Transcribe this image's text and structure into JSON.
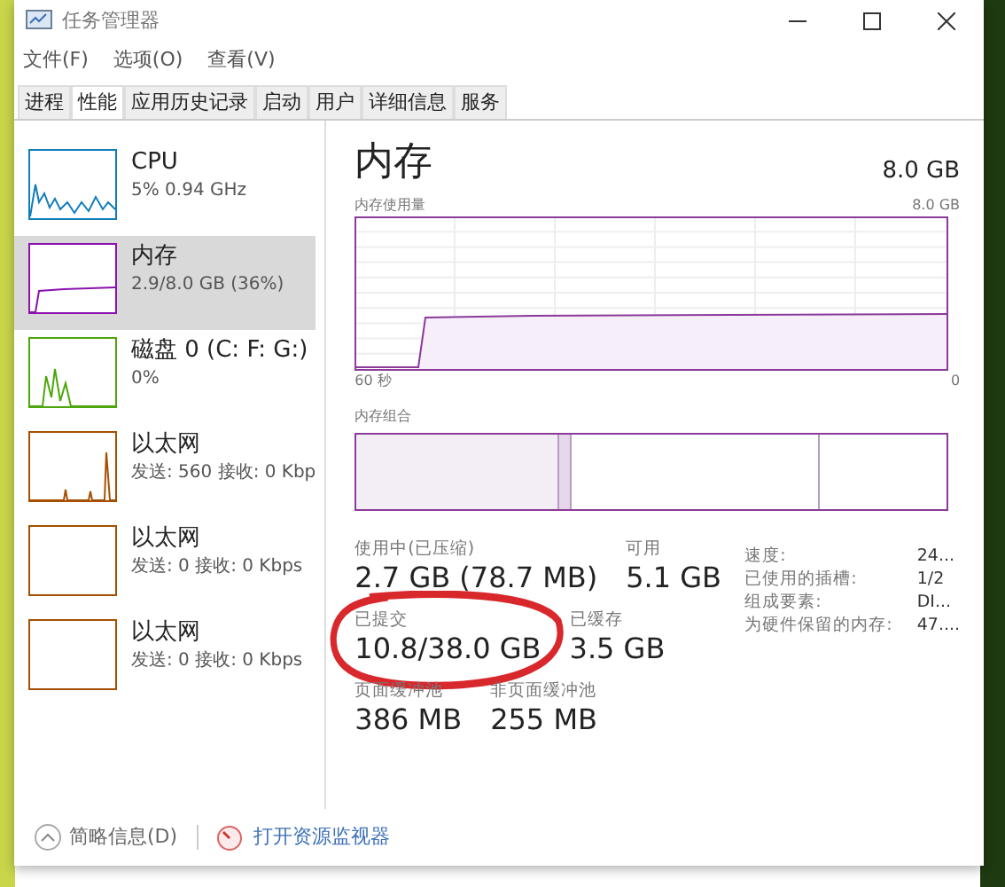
{
  "window": {
    "title": "任务管理器"
  },
  "menu": [
    "文件(F)",
    "选项(O)",
    "查看(V)"
  ],
  "tabs": [
    {
      "label": "进程",
      "selected": false
    },
    {
      "label": "性能",
      "selected": true
    },
    {
      "label": "应用历史记录",
      "selected": false
    },
    {
      "label": "启动",
      "selected": false
    },
    {
      "label": "用户",
      "selected": false
    },
    {
      "label": "详细信息",
      "selected": false
    },
    {
      "label": "服务",
      "selected": false
    }
  ],
  "sidebar": {
    "items": [
      {
        "kind": "cpu",
        "name": "CPU",
        "detail": "5% 0.94 GHz",
        "selected": false
      },
      {
        "kind": "memory",
        "name": "内存",
        "detail": "2.9/8.0 GB (36%)",
        "selected": true
      },
      {
        "kind": "disk",
        "name": "磁盘 0 (C: F: G:)",
        "detail": "0%",
        "selected": false
      },
      {
        "kind": "ethernet",
        "name": "以太网",
        "detail": "发送: 560 接收: 0 Kbp",
        "selected": false
      },
      {
        "kind": "ethernet-idle",
        "name": "以太网",
        "detail": "发送: 0 接收: 0 Kbps",
        "selected": false
      },
      {
        "kind": "ethernet-idle",
        "name": "以太网",
        "detail": "发送: 0 接收: 0 Kbps",
        "selected": false
      }
    ]
  },
  "detail": {
    "title": "内存",
    "total": "8.0 GB",
    "usage_label": "内存使用量",
    "usage_max": "8.0 GB",
    "time_start": "60 秒",
    "time_end": "0",
    "composition_label": "内存组合",
    "stats": [
      [
        {
          "label": "使用中(已压缩)",
          "value": "2.7 GB (78.7 MB)"
        },
        {
          "label": "可用",
          "value": "5.1 GB"
        }
      ],
      [
        {
          "label": "已提交",
          "value": "10.8/38.0 GB",
          "circled": true
        },
        {
          "label": "已缓存",
          "value": "3.5 GB"
        }
      ],
      [
        {
          "label": "页面缓冲池",
          "value": "386 MB"
        },
        {
          "label": "非页面缓冲池",
          "value": "255 MB"
        }
      ]
    ],
    "properties": [
      {
        "label": "速度:",
        "value": "24..."
      },
      {
        "label": "已使用的插槽:",
        "value": "1/2"
      },
      {
        "label": "组成要素:",
        "value": "DI..."
      },
      {
        "label": "为硬件保留的内存:",
        "value": "47...."
      }
    ]
  },
  "footer": {
    "fewer_details": "简略信息(D)",
    "resource_monitor": "打开资源监视器"
  }
}
